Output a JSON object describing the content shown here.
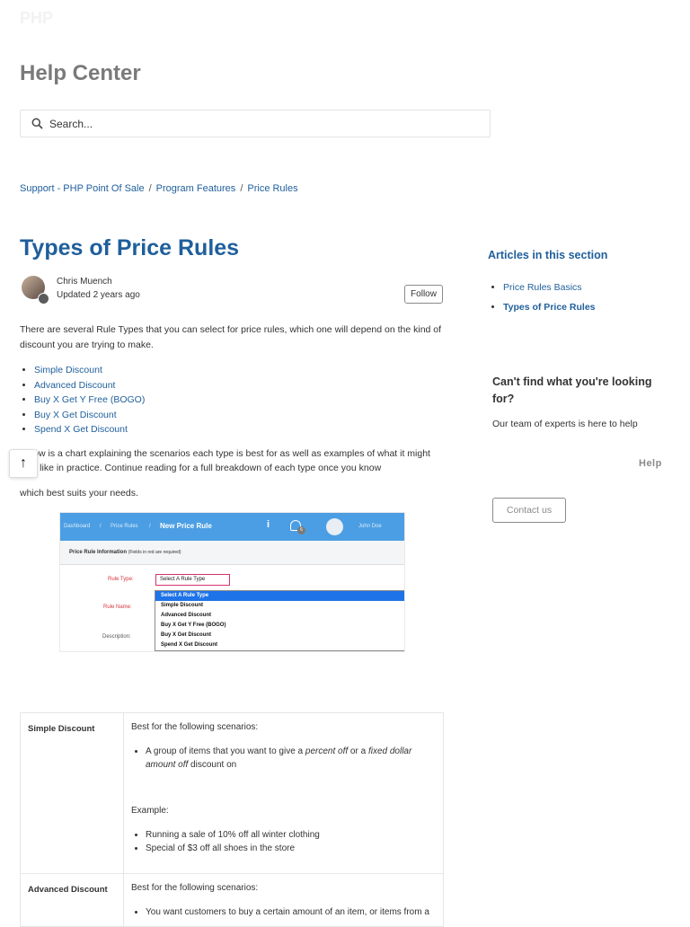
{
  "header": {
    "logo_text": "PHP",
    "title": "Help Center",
    "search_placeholder": "Search..."
  },
  "breadcrumb": [
    {
      "label": "Support - PHP Point Of Sale"
    },
    {
      "label": "Program Features"
    },
    {
      "label": "Price Rules"
    }
  ],
  "article": {
    "title": "Types of Price Rules",
    "author": "Chris Muench",
    "updated": "Updated 2 years ago",
    "follow_label": "Follow",
    "intro": "There are several Rule Types that you can select for price rules, which one will depend on the kind of discount you are trying to make.",
    "rule_types": [
      "Simple Discount",
      "Advanced Discount",
      "Buy X Get Y Free (BOGO)",
      "Buy X Get Discount",
      "Spend X Get Discount"
    ],
    "para2": "Below is a chart explaining the scenarios each type is best for as well as examples of what it might look like in practice. Continue reading for a full breakdown of each type once you know",
    "para3": "which best suits your needs."
  },
  "screenshot": {
    "nav": [
      "Dashboard",
      "/",
      "Price Rules",
      "/"
    ],
    "page": "New Price Rule",
    "user": "John Doe",
    "badge": "6",
    "section_title": "Price Rule Information",
    "section_note": "(Fields in red are required)",
    "label_rule_type": "Rule Type:",
    "label_rule_name": "Rule Name:",
    "label_description": "Description:",
    "selected": "Select A Rule Type",
    "options": [
      "Select A Rule Type",
      "Simple Discount",
      "Advanced Discount",
      "Buy X Get Y Free (BOGO)",
      "Buy X Get Discount",
      "Spend X Get Discount"
    ]
  },
  "table": {
    "rows": [
      {
        "type": "Simple Discount",
        "best_for": "Best for the following scenarios:",
        "scenario_pre": "A group of items that you want to give a ",
        "scenario_em1": "percent off",
        "scenario_mid": " or a ",
        "scenario_em2": "fixed dollar amount off",
        "scenario_post": " discount on",
        "example_label": "Example:",
        "examples": [
          "Running a sale of 10% off all winter clothing",
          "Special of $3 off all shoes in the store"
        ]
      },
      {
        "type": "Advanced Discount",
        "best_for": "Best for the following scenarios:",
        "scenario": "You want customers to buy a certain amount of an item, or items from a"
      }
    ]
  },
  "sidebar": {
    "section_heading": "Articles in this section",
    "articles": [
      "Price Rules Basics",
      "Types of Price Rules"
    ],
    "cant_find": "Can't find what you're looking for?",
    "experts": "Our team of experts is here to help",
    "help_tag": "Help",
    "contact_label": "Contact us"
  },
  "colors": {
    "link": "#1f5f9b",
    "screenshot_bar": "#4b9ee3",
    "dropdown_highlight": "#1e73e8"
  },
  "icons": [
    "search-icon",
    "arrow-up-icon",
    "info-icon",
    "notification-icon",
    "user-avatar-icon"
  ]
}
